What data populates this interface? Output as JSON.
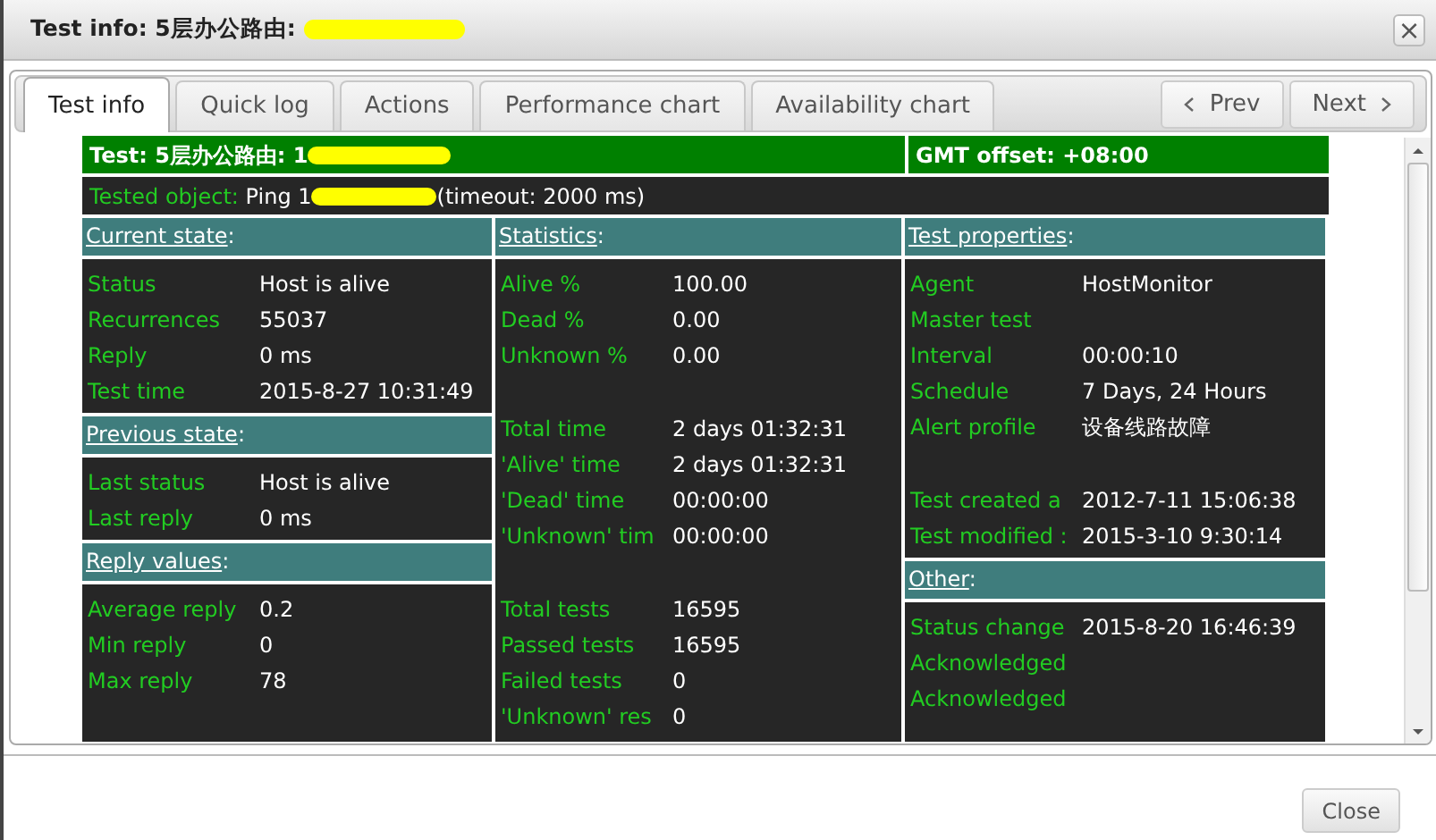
{
  "dialog": {
    "title": "Test info: 5层办公路由:",
    "title_redacted": true,
    "close_glyph": "×"
  },
  "tabs": [
    {
      "label": "Test info",
      "selected": true
    },
    {
      "label": "Quick log",
      "selected": false
    },
    {
      "label": "Actions",
      "selected": false
    },
    {
      "label": "Performance chart",
      "selected": false
    },
    {
      "label": "Availability chart",
      "selected": false
    }
  ],
  "nav": {
    "prev": "Prev",
    "next": "Next"
  },
  "header": {
    "test": "Test: 5层办公路由: 1",
    "test_redacted": true,
    "gmt": "GMT offset: +08:00"
  },
  "tested_object": {
    "label": "Tested object:",
    "value_before": "Ping 1",
    "redacted": true,
    "value_after": "(timeout: 2000 ms)"
  },
  "columns": [
    {
      "sections": [
        {
          "title": "Current state",
          "suffix": ":",
          "groups": [
            [
              {
                "label": "Status",
                "value": "Host is alive"
              },
              {
                "label": "Recurrences",
                "value": "55037"
              },
              {
                "label": "Reply",
                "value": "0 ms"
              },
              {
                "label": "Test time",
                "value": "2015-8-27 10:31:49"
              }
            ]
          ]
        },
        {
          "title": "Previous state",
          "suffix": ":",
          "groups": [
            [
              {
                "label": "Last status",
                "value": "Host is alive"
              },
              {
                "label": "Last reply",
                "value": "0 ms"
              }
            ]
          ]
        },
        {
          "title": "Reply values",
          "suffix": ":",
          "groups": [
            [
              {
                "label": "Average reply",
                "value": "0.2"
              },
              {
                "label": "Min reply",
                "value": "0"
              },
              {
                "label": "Max reply",
                "value": "78"
              }
            ]
          ]
        }
      ]
    },
    {
      "sections": [
        {
          "title": "Statistics",
          "suffix": ":",
          "groups": [
            [
              {
                "label": "Alive %",
                "value": "100.00"
              },
              {
                "label": "Dead %",
                "value": "0.00"
              },
              {
                "label": "Unknown %",
                "value": "0.00"
              }
            ],
            [
              {
                "label": "Total time",
                "value": "2 days 01:32:31"
              },
              {
                "label": "'Alive' time",
                "value": "2 days 01:32:31"
              },
              {
                "label": "'Dead' time",
                "value": "00:00:00"
              },
              {
                "label": "'Unknown' tim",
                "value": "00:00:00"
              }
            ],
            [
              {
                "label": "Total tests",
                "value": "16595"
              },
              {
                "label": "Passed tests",
                "value": "16595"
              },
              {
                "label": "Failed tests",
                "value": "0"
              },
              {
                "label": "'Unknown' res",
                "value": "0"
              }
            ]
          ]
        }
      ]
    },
    {
      "sections": [
        {
          "title": "Test properties",
          "suffix": ":",
          "groups": [
            [
              {
                "label": "Agent",
                "value": "HostMonitor"
              },
              {
                "label": "Master test"
              },
              {
                "label": "Interval",
                "value": "00:00:10"
              },
              {
                "label": "Schedule",
                "value": "7 Days, 24 Hours"
              },
              {
                "label": "Alert profile",
                "value": "设备线路故障"
              }
            ],
            [
              {
                "label": "Test created a",
                "value": "2012-7-11 15:06:38"
              },
              {
                "label": "Test modified :",
                "value": "2015-3-10 9:30:14"
              }
            ]
          ]
        },
        {
          "title": "Other",
          "suffix": ":",
          "groups": [
            [
              {
                "label": "Status change",
                "value": "2015-8-20 16:46:39"
              },
              {
                "label": "Acknowledged"
              },
              {
                "label": "Acknowledged"
              }
            ]
          ]
        }
      ]
    }
  ],
  "footer": {
    "close": "Close"
  }
}
